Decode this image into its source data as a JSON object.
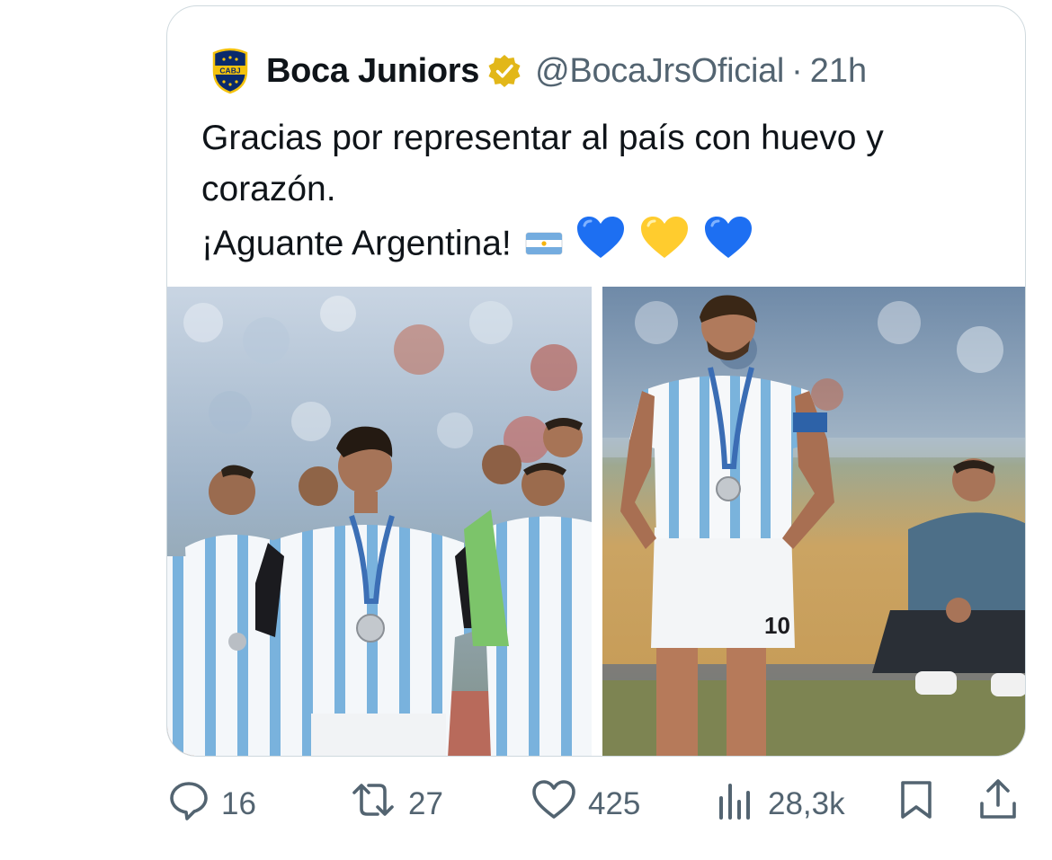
{
  "tweet": {
    "avatar_text": "CABJ",
    "author_name": "Boca Juniors",
    "handle": "@BocaJrsOficial",
    "separator": "·",
    "time": "21h",
    "text_line1": "Gracias por representar al país con huevo y corazón.",
    "text_line2": "¡Aguante Argentina!",
    "emojis": [
      "flag-argentina",
      "blue-heart",
      "yellow-heart",
      "blue-heart"
    ],
    "jersey_number": "10"
  },
  "actions": {
    "replies": "16",
    "retweets": "27",
    "likes": "425",
    "views": "28,3k"
  },
  "icons": [
    "reply-icon",
    "retweet-icon",
    "like-icon",
    "views-icon",
    "bookmark-icon",
    "share-icon"
  ],
  "colors": {
    "text": "#0f1419",
    "secondary": "#536471",
    "border": "#cfd9de",
    "verified_gold": "#e2b719",
    "heart_blue": "#1d6ff2",
    "heart_yellow": "#ffcc2e",
    "boca_blue": "#0a2a6c",
    "boca_gold": "#f4c20d"
  }
}
